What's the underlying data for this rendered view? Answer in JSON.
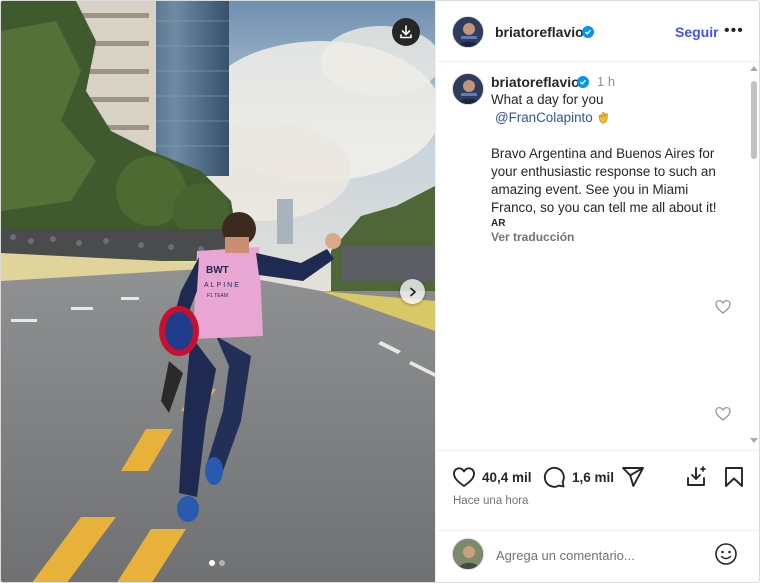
{
  "post": {
    "author": "briatoreflavio",
    "follow_label": "Seguir",
    "more_label": "•••"
  },
  "caption": {
    "author": "briatoreflavio",
    "time": "1 h",
    "line1": "What a day for you",
    "mention": "@FranColapinto",
    "body": "Bravo Argentina and Buenos Aires for your enthusiastic response to such an amazing event. See you in Miami Franco, so you can tell me all about it!",
    "lang": "AR",
    "translate_label": "Ver traducción"
  },
  "stats": {
    "likes": "40,4 mil",
    "comments": "1,6 mil",
    "posted_ago": "Hace una hora"
  },
  "composer": {
    "placeholder": "Agrega un comentario..."
  },
  "photo": {
    "suit_lines": [
      "BWT",
      "ALPINE",
      "F1 TEAM"
    ],
    "slides": 2,
    "active_slide": 1
  },
  "icons": [
    "download-icon",
    "chevron-right-icon",
    "verified-icon",
    "heart-icon",
    "comment-icon",
    "share-icon",
    "save-icon",
    "bookmark-icon",
    "emoji-icon",
    "clapping-hands-icon"
  ],
  "colors": {
    "verified": "#0095f6",
    "follow": "#4150f7",
    "mention": "#3452a5",
    "suit_pink": "#e8a6d3",
    "suit_navy": "#1e2a52",
    "road_line": "#e8b23a"
  }
}
